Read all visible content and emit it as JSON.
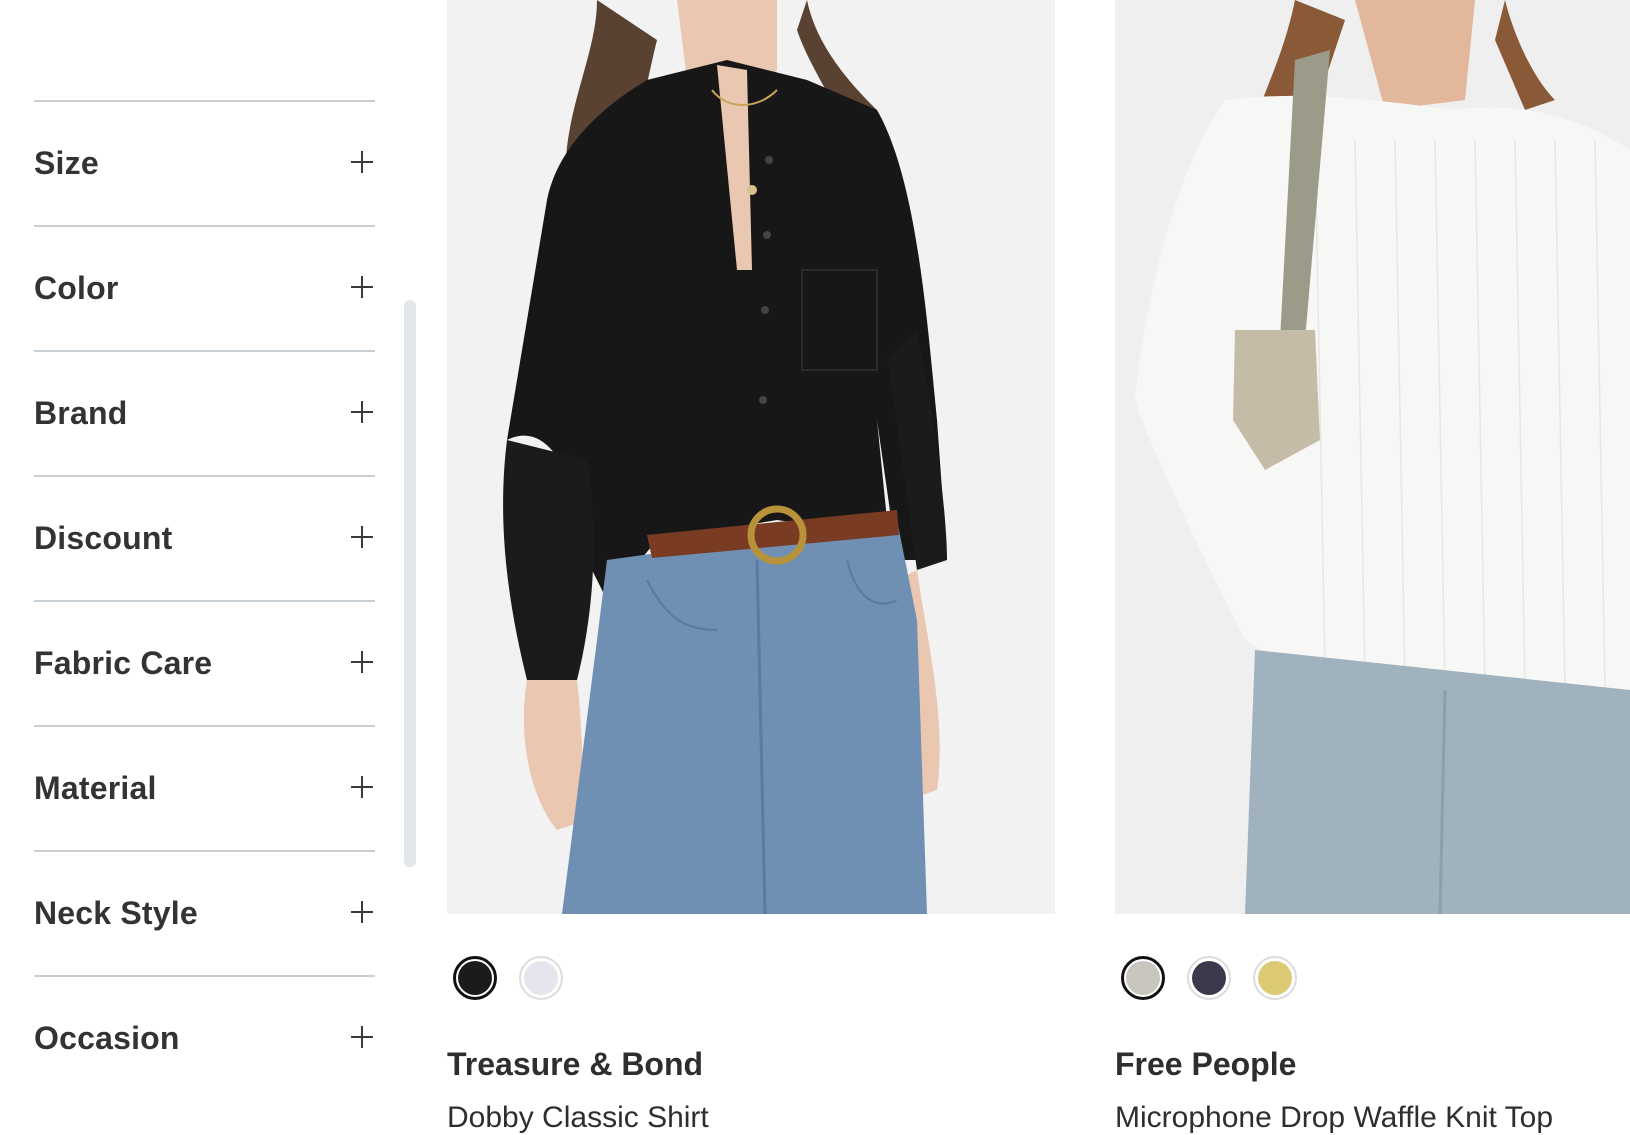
{
  "filters": [
    {
      "label": "Size"
    },
    {
      "label": "Color"
    },
    {
      "label": "Brand"
    },
    {
      "label": "Discount"
    },
    {
      "label": "Fabric Care"
    },
    {
      "label": "Material"
    },
    {
      "label": "Neck Style"
    },
    {
      "label": "Occasion"
    }
  ],
  "products": [
    {
      "brand": "Treasure & Bond",
      "name": "Dobby Classic Shirt",
      "swatches": [
        {
          "color": "#1c1a1b",
          "selected": true
        },
        {
          "color": "#e6e4ec",
          "selected": false
        }
      ]
    },
    {
      "brand": "Free People",
      "name": "Microphone Drop Waffle Knit Top",
      "swatches": [
        {
          "color": "#c9c6c0",
          "selected": true
        },
        {
          "color": "#3b3a4c",
          "selected": false
        },
        {
          "color": "#dccb74",
          "selected": false
        }
      ]
    }
  ]
}
